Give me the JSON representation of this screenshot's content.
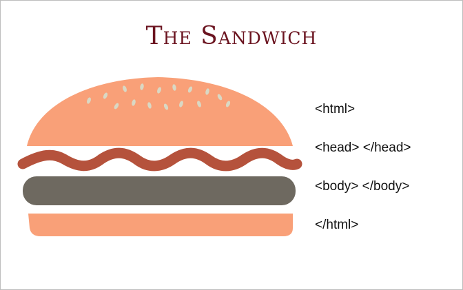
{
  "title": "The Sandwich",
  "colors": {
    "title": "#6b1420",
    "bun": "#f9a078",
    "ketchup": "#b5523c",
    "patty": "#6e6960",
    "seeds": "#d9d8c4",
    "text": "#111111"
  },
  "layers": [
    {
      "part": "top-bun",
      "tag": "<html>"
    },
    {
      "part": "ketchup",
      "tag": "<head> </head>"
    },
    {
      "part": "patty",
      "tag": "<body> </body>"
    },
    {
      "part": "bottom-bun",
      "tag": "</html>"
    }
  ]
}
